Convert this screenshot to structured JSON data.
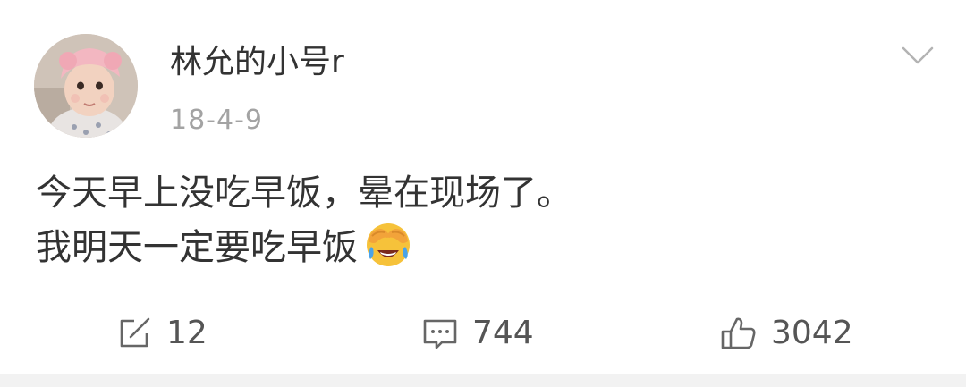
{
  "post": {
    "author": "林允的小号r",
    "timestamp": "18-4-9",
    "lines": [
      "今天早上没吃早饭，晕在现场了。",
      "我明天一定要吃早饭"
    ],
    "emoji": "crying-laughing-face"
  },
  "actions": {
    "repost_count": "12",
    "comment_count": "744",
    "like_count": "3042"
  },
  "colors": {
    "text": "#333333",
    "muted": "#a3a3a3",
    "icon": "#666666",
    "divider": "#e6e6e6",
    "background_strip": "#f2f2f2"
  }
}
